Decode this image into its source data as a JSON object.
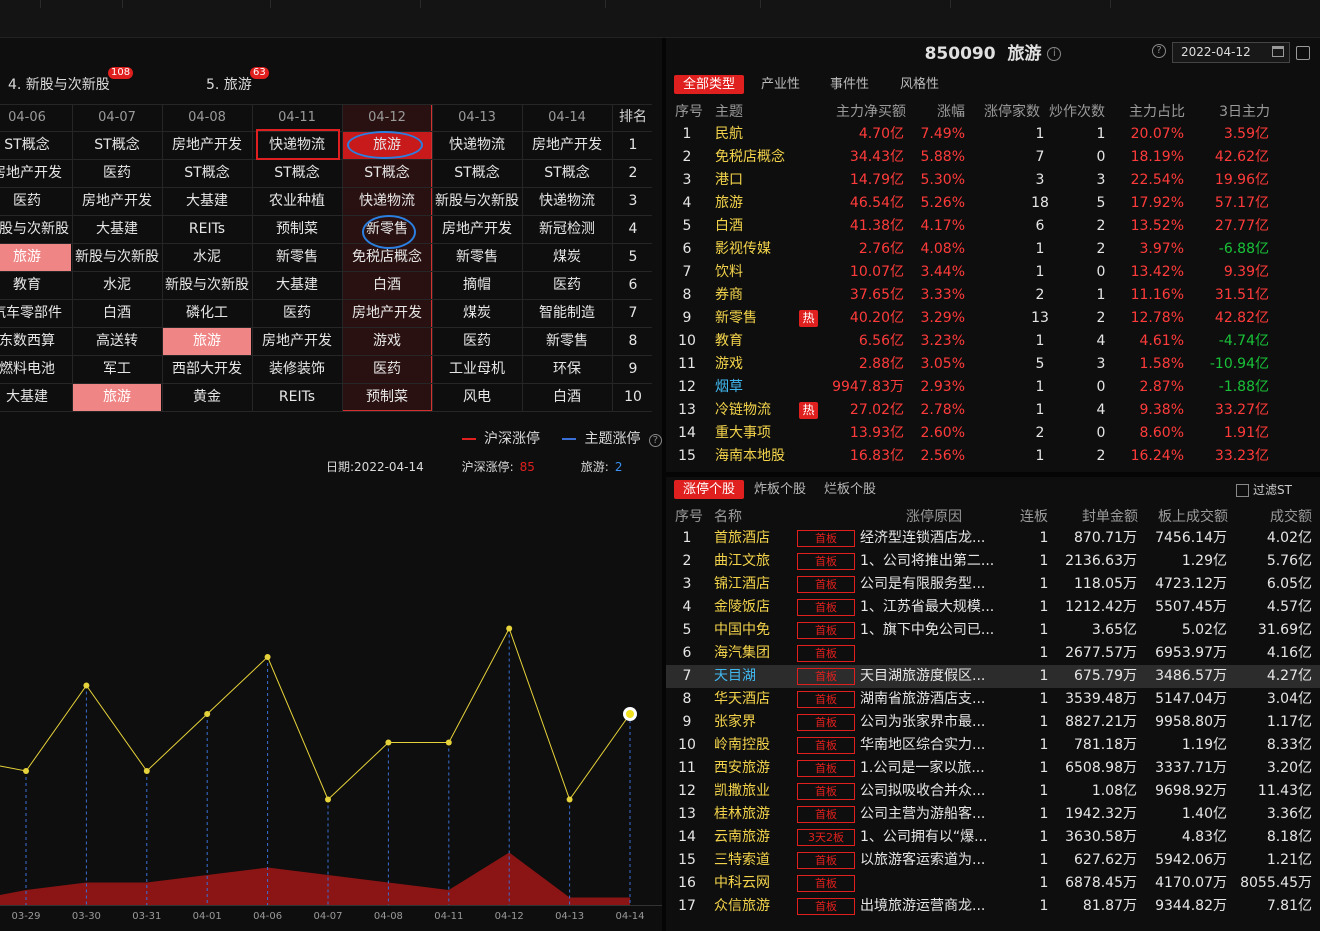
{
  "section_tabs": [
    {
      "label": "4. 新股与次新股",
      "badge": "108"
    },
    {
      "label": "5. 旅游",
      "badge": "63"
    }
  ],
  "grid": {
    "rank_header": "排名",
    "columns": [
      {
        "date": "04-06",
        "items": [
          "ST概念",
          "房地产开发",
          "医药",
          "新股与次新股",
          "旅游",
          "教育",
          "汽车零部件",
          "东数西算",
          "燃料电池",
          "大基建"
        ]
      },
      {
        "date": "04-07",
        "items": [
          "ST概念",
          "医药",
          "房地产开发",
          "大基建",
          "新股与次新股",
          "水泥",
          "白酒",
          "高送转",
          "军工",
          "旅游"
        ]
      },
      {
        "date": "04-08",
        "items": [
          "房地产开发",
          "ST概念",
          "大基建",
          "REITs",
          "水泥",
          "新股与次新股",
          "磷化工",
          "旅游",
          "西部大开发",
          "黄金"
        ]
      },
      {
        "date": "04-11",
        "items": [
          "快递物流",
          "ST概念",
          "农业种植",
          "预制菜",
          "新零售",
          "大基建",
          "医药",
          "房地产开发",
          "装修装饰",
          "REITs"
        ]
      },
      {
        "date": "04-12",
        "items": [
          "旅游",
          "ST概念",
          "快递物流",
          "新零售",
          "免税店概念",
          "白酒",
          "房地产开发",
          "游戏",
          "医药",
          "预制菜"
        ]
      },
      {
        "date": "04-13",
        "items": [
          "快递物流",
          "ST概念",
          "新股与次新股",
          "房地产开发",
          "新零售",
          "摘帽",
          "煤炭",
          "医药",
          "工业母机",
          "风电"
        ]
      },
      {
        "date": "04-14",
        "items": [
          "房地产开发",
          "ST概念",
          "快递物流",
          "新冠检测",
          "煤炭",
          "医药",
          "智能制造",
          "新零售",
          "环保",
          "白酒"
        ]
      }
    ],
    "ranks": [
      "1",
      "2",
      "3",
      "4",
      "5",
      "6",
      "7",
      "8",
      "9",
      "10"
    ]
  },
  "chart_legend": {
    "series1": "沪深涨停",
    "series2": "主题涨停"
  },
  "chart_info": {
    "date_label": "日期:",
    "date": "2022-04-14",
    "hs_label": "沪深涨停:",
    "hs_value": "85",
    "theme_label": "旅游:",
    "theme_value": "2"
  },
  "chart_data": {
    "type": "line",
    "x": [
      "03-29",
      "03-30",
      "03-31",
      "04-01",
      "04-06",
      "04-07",
      "04-08",
      "04-11",
      "04-12",
      "04-13",
      "04-14"
    ],
    "series": [
      {
        "name": "主题涨停",
        "values": [
          4,
          7,
          4,
          6,
          8,
          3,
          5,
          5,
          9,
          3,
          6
        ]
      }
    ],
    "area_values": [
      2,
      3,
      3,
      4,
      5,
      4,
      3,
      2,
      7,
      1,
      1
    ],
    "colors": {
      "line": "#e6d23a",
      "area": "#8b1414",
      "dash": "#3a6fd8"
    }
  },
  "right_header": {
    "code": "850090",
    "name": "旅游",
    "date": "2022-04-12"
  },
  "filter_tabs": [
    "全部类型",
    "产业性",
    "事件性",
    "风格性"
  ],
  "theme_table": {
    "headers": [
      "序号",
      "主题",
      "主力净买额",
      "涨幅",
      "涨停家数",
      "炒作次数",
      "主力占比",
      "3日主力"
    ],
    "rows": [
      {
        "n": "1",
        "name": "民航",
        "hot": "",
        "buy": "4.70亿",
        "chg": "7.49%",
        "lim": "1",
        "times": "1",
        "ratio": "20.07%",
        "d3": "3.59亿",
        "d3c": "red",
        "nc": "yellow"
      },
      {
        "n": "2",
        "name": "免税店概念",
        "hot": "",
        "buy": "34.43亿",
        "chg": "5.88%",
        "lim": "7",
        "times": "0",
        "ratio": "18.19%",
        "d3": "42.62亿",
        "d3c": "red",
        "nc": "yellow"
      },
      {
        "n": "3",
        "name": "港口",
        "hot": "",
        "buy": "14.79亿",
        "chg": "5.30%",
        "lim": "3",
        "times": "3",
        "ratio": "22.54%",
        "d3": "19.96亿",
        "d3c": "red",
        "nc": "yellow"
      },
      {
        "n": "4",
        "name": "旅游",
        "hot": "",
        "buy": "46.54亿",
        "chg": "5.26%",
        "lim": "18",
        "times": "5",
        "ratio": "17.92%",
        "d3": "57.17亿",
        "d3c": "red",
        "nc": "yellow"
      },
      {
        "n": "5",
        "name": "白酒",
        "hot": "",
        "buy": "41.38亿",
        "chg": "4.17%",
        "lim": "6",
        "times": "2",
        "ratio": "13.52%",
        "d3": "27.77亿",
        "d3c": "red",
        "nc": "yellow"
      },
      {
        "n": "6",
        "name": "影视传媒",
        "hot": "",
        "buy": "2.76亿",
        "chg": "4.08%",
        "lim": "1",
        "times": "2",
        "ratio": "3.97%",
        "d3": "-6.88亿",
        "d3c": "green",
        "nc": "yellow"
      },
      {
        "n": "7",
        "name": "饮料",
        "hot": "",
        "buy": "10.07亿",
        "chg": "3.44%",
        "lim": "1",
        "times": "0",
        "ratio": "13.42%",
        "d3": "9.39亿",
        "d3c": "red",
        "nc": "yellow"
      },
      {
        "n": "8",
        "name": "券商",
        "hot": "",
        "buy": "37.65亿",
        "chg": "3.33%",
        "lim": "2",
        "times": "1",
        "ratio": "11.16%",
        "d3": "31.51亿",
        "d3c": "red",
        "nc": "yellow"
      },
      {
        "n": "9",
        "name": "新零售",
        "hot": "热",
        "buy": "40.20亿",
        "chg": "3.29%",
        "lim": "13",
        "times": "2",
        "ratio": "12.78%",
        "d3": "42.82亿",
        "d3c": "red",
        "nc": "yellow"
      },
      {
        "n": "10",
        "name": "教育",
        "hot": "",
        "buy": "6.56亿",
        "chg": "3.23%",
        "lim": "1",
        "times": "4",
        "ratio": "4.61%",
        "d3": "-4.74亿",
        "d3c": "green",
        "nc": "yellow"
      },
      {
        "n": "11",
        "name": "游戏",
        "hot": "",
        "buy": "2.88亿",
        "chg": "3.05%",
        "lim": "5",
        "times": "3",
        "ratio": "1.58%",
        "d3": "-10.94亿",
        "d3c": "green",
        "nc": "yellow"
      },
      {
        "n": "12",
        "name": "烟草",
        "hot": "",
        "buy": "9947.83万",
        "chg": "2.93%",
        "lim": "1",
        "times": "0",
        "ratio": "2.87%",
        "d3": "-1.88亿",
        "d3c": "green",
        "nc": "cyan"
      },
      {
        "n": "13",
        "name": "冷链物流",
        "hot": "热",
        "buy": "27.02亿",
        "chg": "2.78%",
        "lim": "1",
        "times": "4",
        "ratio": "9.38%",
        "d3": "33.27亿",
        "d3c": "red",
        "nc": "yellow"
      },
      {
        "n": "14",
        "name": "重大事项",
        "hot": "",
        "buy": "13.93亿",
        "chg": "2.60%",
        "lim": "2",
        "times": "0",
        "ratio": "8.60%",
        "d3": "1.91亿",
        "d3c": "red",
        "nc": "yellow"
      },
      {
        "n": "15",
        "name": "海南本地股",
        "hot": "",
        "buy": "16.83亿",
        "chg": "2.56%",
        "lim": "1",
        "times": "2",
        "ratio": "16.24%",
        "d3": "33.23亿",
        "d3c": "red",
        "nc": "yellow"
      }
    ]
  },
  "stock_tabs": [
    "涨停个股",
    "炸板个股",
    "烂板个股"
  ],
  "filter_st": "过滤ST",
  "stock_table": {
    "headers": [
      "序号",
      "名称",
      "涨停原因",
      "连板",
      "封单金额",
      "板上成交额",
      "成交额"
    ],
    "rows": [
      {
        "n": "1",
        "name": "首旅酒店",
        "tag": "首板",
        "reason": "经济型连锁酒店龙...",
        "lb": "1",
        "fd": "870.71万",
        "bs": "7456.14万",
        "cj": "4.02亿",
        "nc": "yellow"
      },
      {
        "n": "2",
        "name": "曲江文旅",
        "tag": "首板",
        "reason": "1、公司将推出第二...",
        "lb": "1",
        "fd": "2136.63万",
        "bs": "1.29亿",
        "cj": "5.76亿",
        "nc": "yellow"
      },
      {
        "n": "3",
        "name": "锦江酒店",
        "tag": "首板",
        "reason": "公司是有限服务型...",
        "lb": "1",
        "fd": "118.05万",
        "bs": "4723.12万",
        "cj": "6.05亿",
        "nc": "yellow"
      },
      {
        "n": "4",
        "name": "金陵饭店",
        "tag": "首板",
        "reason": "1、江苏省最大规模...",
        "lb": "1",
        "fd": "1212.42万",
        "bs": "5507.45万",
        "cj": "4.57亿",
        "nc": "yellow"
      },
      {
        "n": "5",
        "name": "中国中免",
        "tag": "首板",
        "reason": "1、旗下中免公司已...",
        "lb": "1",
        "fd": "3.65亿",
        "bs": "5.02亿",
        "cj": "31.69亿",
        "nc": "yellow"
      },
      {
        "n": "6",
        "name": "海汽集团",
        "tag": "首板",
        "reason": "",
        "lb": "1",
        "fd": "2677.57万",
        "bs": "6953.97万",
        "cj": "4.16亿",
        "nc": "yellow"
      },
      {
        "n": "7",
        "name": "天目湖",
        "tag": "首板",
        "reason": "天目湖旅游度假区...",
        "lb": "1",
        "fd": "675.79万",
        "bs": "3486.57万",
        "cj": "4.27亿",
        "nc": "cyan"
      },
      {
        "n": "8",
        "name": "华天酒店",
        "tag": "首板",
        "reason": "湖南省旅游酒店支...",
        "lb": "1",
        "fd": "3539.48万",
        "bs": "5147.04万",
        "cj": "3.04亿",
        "nc": "yellow"
      },
      {
        "n": "9",
        "name": "张家界",
        "tag": "首板",
        "reason": "公司为张家界市最...",
        "lb": "1",
        "fd": "8827.21万",
        "bs": "9958.80万",
        "cj": "1.17亿",
        "nc": "yellow"
      },
      {
        "n": "10",
        "name": "岭南控股",
        "tag": "首板",
        "reason": "华南地区综合实力...",
        "lb": "1",
        "fd": "781.18万",
        "bs": "1.19亿",
        "cj": "8.33亿",
        "nc": "yellow"
      },
      {
        "n": "11",
        "name": "西安旅游",
        "tag": "首板",
        "reason": "1.公司是一家以旅...",
        "lb": "1",
        "fd": "6508.98万",
        "bs": "3337.71万",
        "cj": "3.20亿",
        "nc": "yellow"
      },
      {
        "n": "12",
        "name": "凯撒旅业",
        "tag": "首板",
        "reason": "公司拟吸收合并众...",
        "lb": "1",
        "fd": "1.08亿",
        "bs": "9698.92万",
        "cj": "11.43亿",
        "nc": "yellow"
      },
      {
        "n": "13",
        "name": "桂林旅游",
        "tag": "首板",
        "reason": "公司主营为游船客...",
        "lb": "1",
        "fd": "1942.32万",
        "bs": "1.40亿",
        "cj": "3.36亿",
        "nc": "yellow"
      },
      {
        "n": "14",
        "name": "云南旅游",
        "tag": "3天2板",
        "reason": "1、公司拥有以“爆...",
        "lb": "1",
        "fd": "3630.58万",
        "bs": "4.83亿",
        "cj": "8.18亿",
        "nc": "yellow"
      },
      {
        "n": "15",
        "name": "三特索道",
        "tag": "首板",
        "reason": "以旅游客运索道为...",
        "lb": "1",
        "fd": "627.62万",
        "bs": "5942.06万",
        "cj": "1.21亿",
        "nc": "yellow"
      },
      {
        "n": "16",
        "name": "中科云网",
        "tag": "首板",
        "reason": "",
        "lb": "1",
        "fd": "6878.45万",
        "bs": "4170.07万",
        "cj": "8055.45万",
        "nc": "yellow"
      },
      {
        "n": "17",
        "name": "众信旅游",
        "tag": "首板",
        "reason": "出境旅游运营商龙...",
        "lb": "1",
        "fd": "81.87万",
        "bs": "9344.82万",
        "cj": "7.81亿",
        "nc": "yellow"
      }
    ]
  }
}
